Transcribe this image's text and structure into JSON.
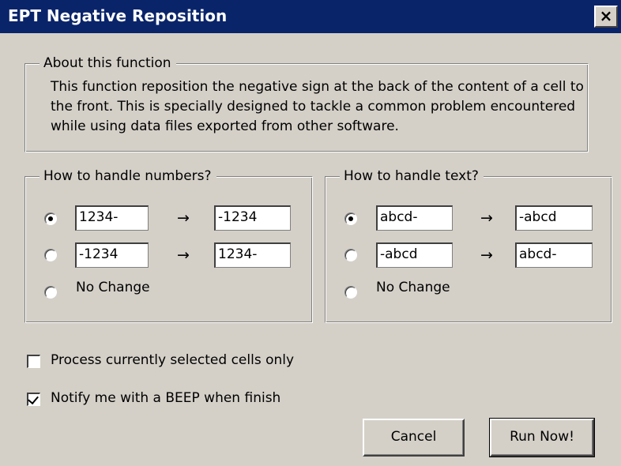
{
  "window": {
    "title": "EPT Negative Reposition",
    "close_glyph": "×"
  },
  "about": {
    "legend": "About this function",
    "text": "This function reposition the negative sign at the back of the content of a cell to the front. This is specially designed to tackle a common problem encountered while using data files exported from other software."
  },
  "numbers": {
    "legend": "How to handle numbers?",
    "options": [
      {
        "from": "1234-",
        "arrow": "→",
        "to": "-1234",
        "selected": true
      },
      {
        "from": "-1234",
        "arrow": "→",
        "to": "1234-",
        "selected": false
      }
    ],
    "no_change_label": "No Change"
  },
  "text": {
    "legend": "How to handle text?",
    "options": [
      {
        "from": "abcd-",
        "arrow": "→",
        "to": "-abcd",
        "selected": true
      },
      {
        "from": "-abcd",
        "arrow": "→",
        "to": "abcd-",
        "selected": false
      }
    ],
    "no_change_label": "No Change"
  },
  "checkboxes": {
    "process_selected": {
      "label": "Process currently selected cells only",
      "checked": false
    },
    "notify_beep": {
      "label": "Notify me with a BEEP when finish",
      "checked": true
    }
  },
  "buttons": {
    "cancel": "Cancel",
    "run_now": "Run Now!"
  },
  "colors": {
    "titlebar": "#0a246a",
    "face": "#d4d0c8"
  }
}
